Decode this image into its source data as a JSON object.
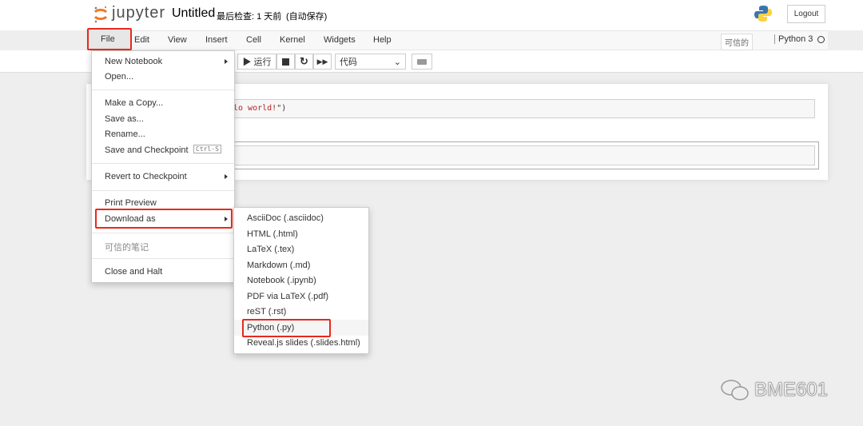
{
  "header": {
    "logo_text": "jupyter",
    "notebook_name": "Untitled",
    "checkpoint": "最后检查: 1 天前",
    "autosave": "(自动保存)",
    "logout": "Logout"
  },
  "menubar": {
    "items": [
      "File",
      "Edit",
      "View",
      "Insert",
      "Cell",
      "Kernel",
      "Widgets",
      "Help"
    ],
    "trusted": "可信的",
    "kernel": "Python 3"
  },
  "toolbar": {
    "run": "▶ 运行",
    "cell_type": "代码"
  },
  "cells": [
    {
      "code_prefix": "lo world!",
      "code_suffix": "\")"
    }
  ],
  "file_menu": {
    "items": [
      "New Notebook",
      "Open...",
      "Make a Copy...",
      "Save as...",
      "Rename...",
      "Save and Checkpoint",
      "Revert to Checkpoint",
      "Print Preview",
      "Download as",
      "可信的笔记",
      "Close and Halt"
    ],
    "shortcut": "Ctrl-S"
  },
  "download_submenu": {
    "items": [
      "AsciiDoc (.asciidoc)",
      "HTML (.html)",
      "LaTeX (.tex)",
      "Markdown (.md)",
      "Notebook (.ipynb)",
      "PDF via LaTeX (.pdf)",
      "reST (.rst)",
      "Python (.py)",
      "Reveal.js slides (.slides.html)"
    ],
    "highlighted": "Python (.py)"
  },
  "watermark": "BME601",
  "colors": {
    "highlight": "#e8291c",
    "jupyter_orange": "#f37726"
  }
}
